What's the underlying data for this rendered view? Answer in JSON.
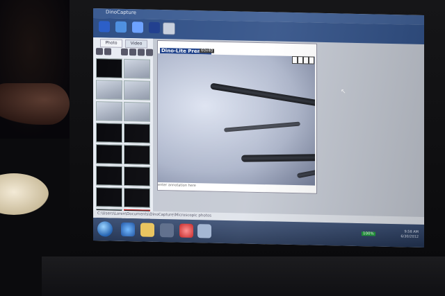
{
  "app": {
    "title": "DinoCapture"
  },
  "tabs": [
    {
      "label": "Photo"
    },
    {
      "label": "Video"
    }
  ],
  "preview": {
    "title": "Dino-Lite Premier",
    "chip": "60x40",
    "annotation": "enter annotation here"
  },
  "draw_tools": {
    "text_tool": "A"
  },
  "pathbar": {
    "text": "C:\\Users\\Loren\\Documents\\DinoCapture\\Microscopic photos"
  },
  "tray": {
    "badge": "100%",
    "time": "9:58 AM",
    "date": "6/30/2012"
  },
  "colors": {
    "taskbar": "#223352",
    "titlebar": "#3c5c92",
    "selected_thumb_border": "#dd2222"
  }
}
